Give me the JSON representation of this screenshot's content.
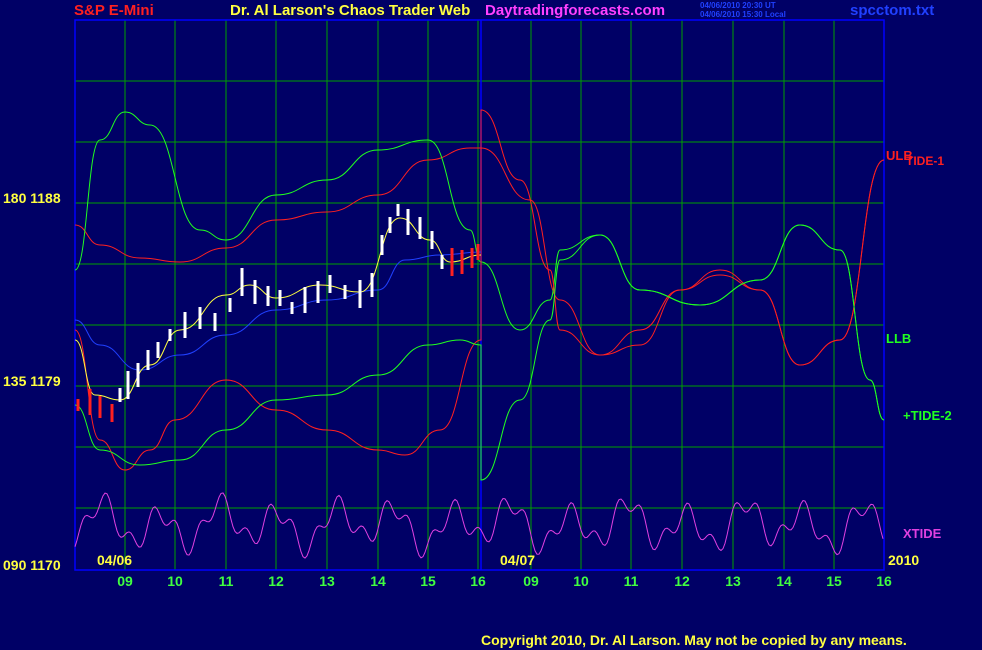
{
  "header": {
    "symbol": "S&P E-Mini",
    "title": "Dr. Al Larson's Chaos Trader Web",
    "site": "Daytradingforecasts.com",
    "time_ut": "04/06/2010 20:30 UT",
    "time_local": "04/06/2010 15:30 Local",
    "file": "spcctom.txt"
  },
  "footer": {
    "copyright": "Copyright 2010, Dr. Al Larson. May not be copied by any means."
  },
  "colors": {
    "background": "#000066",
    "grid": "#00a000",
    "frame": "#0000ff",
    "ulb": "#ff2020",
    "llb": "#20ff20",
    "xtide": "#e040e0",
    "price_up": "#ffffff",
    "price_down": "#ff2020",
    "avg": "#ffff40",
    "avg_slow": "#2040ff"
  },
  "chart_data": {
    "type": "line",
    "title": "S&P E-Mini",
    "ylabel_left_ticks": [
      "180 1188",
      "135 1179",
      "090 1170"
    ],
    "ylim": [
      1170,
      1196
    ],
    "x_ticks_day1": [
      "09",
      "10",
      "11",
      "12",
      "13",
      "14",
      "15",
      "16"
    ],
    "x_ticks_day2": [
      "09",
      "10",
      "11",
      "12",
      "13",
      "14",
      "15",
      "16"
    ],
    "date_labels": [
      "04/06",
      "04/07"
    ],
    "year": "2010",
    "right_labels": {
      "ulb": "ULB",
      "tide1": "TIDE-1",
      "llb": "LLB",
      "tide2": "+TIDE-2",
      "xtide": "XTIDE"
    },
    "series": [
      {
        "name": "ULB",
        "x": [
          8.5,
          9,
          9.5,
          10,
          10.5,
          11,
          11.5,
          12,
          12.5,
          13,
          13.5,
          14,
          14.5,
          15,
          15.5,
          16
        ],
        "values": [
          1186.6,
          1185.3,
          1184.9,
          1185.1,
          1185.5,
          1186.0,
          1186.7,
          1187.3,
          1187.5,
          1187.8,
          1188.4,
          1188.6,
          1189.2,
          1189.9,
          1190.5,
          1191.0
        ]
      },
      {
        "name": "LLB",
        "x": [
          8.5,
          9,
          9.5,
          10,
          10.5,
          11,
          11.5,
          12,
          12.5,
          13,
          13.5,
          14,
          14.5,
          15,
          15.5,
          16
        ],
        "values": [
          1178.1,
          1175.9,
          1175.5,
          1175.8,
          1176.0,
          1176.6,
          1177.2,
          1177.9,
          1178.2,
          1178.1,
          1178.5,
          1179.0,
          1179.6,
          1180.1,
          1180.6,
          1180.5
        ]
      },
      {
        "name": "XTIDE",
        "note": "oscillator",
        "x": [
          8.5,
          16
        ],
        "values": [
          1173.6,
          1172.8
        ]
      }
    ],
    "price_range": {
      "open": 1177.7,
      "high": 1188.4,
      "low": 1177.1,
      "close": 1183.6
    }
  }
}
